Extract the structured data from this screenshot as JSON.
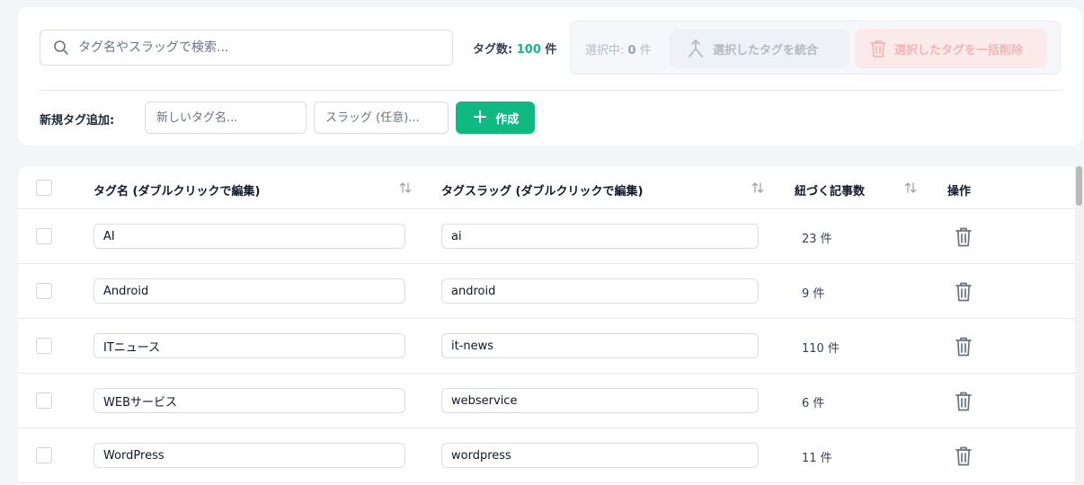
{
  "search": {
    "placeholder": "タグ名やスラッグで検索..."
  },
  "tag_count": {
    "label": "タグ数:",
    "value": "100",
    "unit": "件"
  },
  "bulk": {
    "selected_label": "選択中:",
    "selected_value": "0",
    "selected_unit": "件",
    "merge_label": "選択したタグを統合",
    "delete_label": "選択したタグを一括削除"
  },
  "new_tag": {
    "label": "新規タグ追加:",
    "name_placeholder": "新しいタグ名...",
    "slug_placeholder": "スラッグ (任意)...",
    "create_label": "作成",
    "create_icon": "+"
  },
  "table": {
    "headers": {
      "name": "タグ名 (ダブルクリックで編集)",
      "slug": "タグスラッグ (ダブルクリックで編集)",
      "count": "紐づく記事数",
      "actions": "操作"
    },
    "rows": [
      {
        "name": "AI",
        "slug": "ai",
        "count": "23 件"
      },
      {
        "name": "Android",
        "slug": "android",
        "count": "9 件"
      },
      {
        "name": "ITニュース",
        "slug": "it-news",
        "count": "110 件"
      },
      {
        "name": "WEBサービス",
        "slug": "webservice",
        "count": "6 件"
      },
      {
        "name": "WordPress",
        "slug": "wordpress",
        "count": "11 件"
      }
    ]
  },
  "colors": {
    "accent": "#10b981",
    "danger_soft": "#f3b6b6"
  }
}
